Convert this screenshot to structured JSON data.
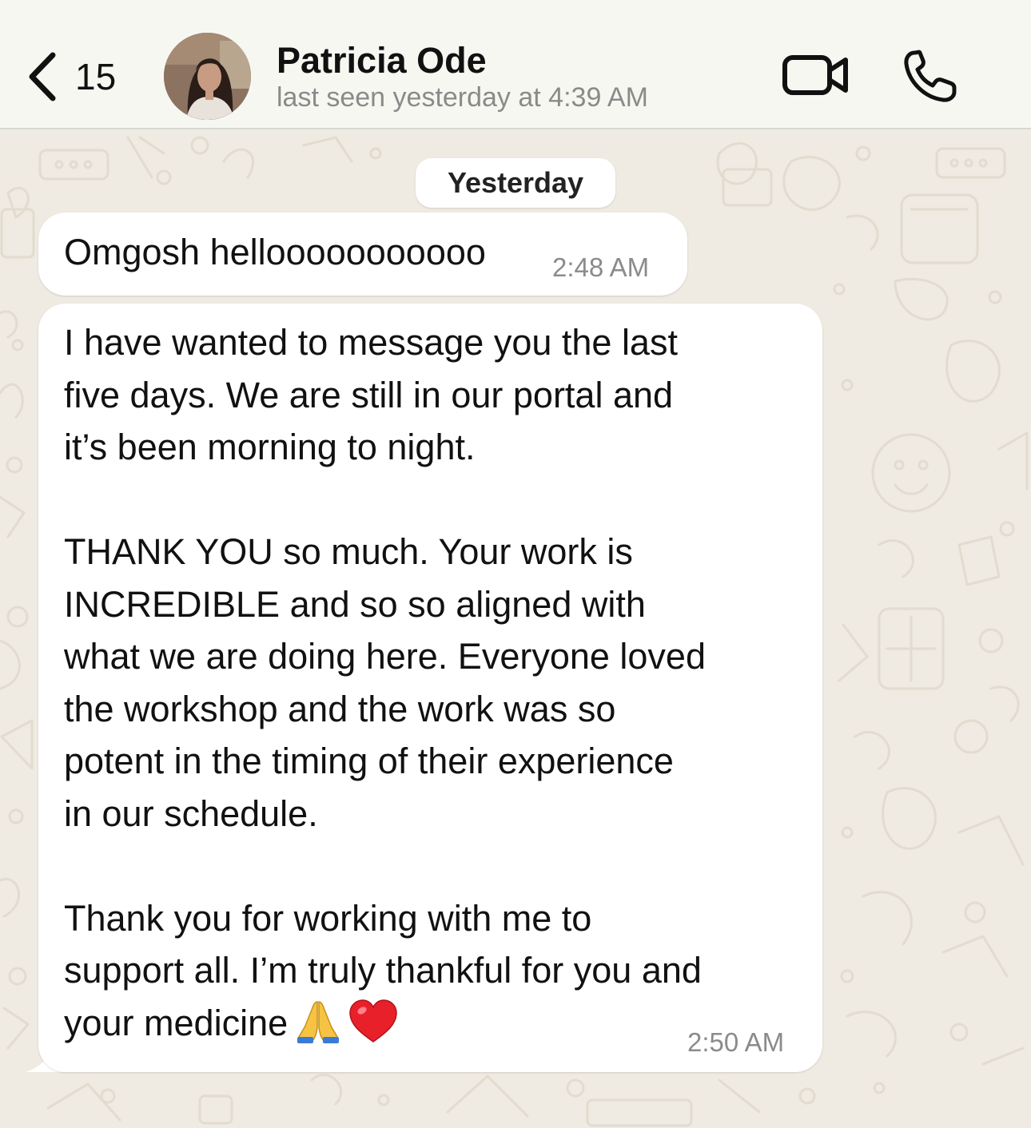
{
  "header": {
    "back_count": "15",
    "contact_name": "Patricia Ode",
    "last_seen": "last seen yesterday at 4:39 AM",
    "icons": [
      "chevron-left-icon",
      "video-camera-icon",
      "phone-icon"
    ]
  },
  "chat": {
    "date_label": "Yesterday",
    "messages": [
      {
        "lines": [
          "Omgosh hellooooooooooo"
        ],
        "time": "2:48 AM"
      },
      {
        "lines": [
          "I have wanted to message you the last",
          "five days. We are still in our portal and",
          "it’s been morning to night.",
          "",
          "THANK YOU so much. Your work is",
          "INCREDIBLE and so so aligned with",
          "what we are doing here. Everyone loved",
          "the workshop and the work was so",
          "potent in the timing of their experience",
          "in our schedule.",
          "",
          "Thank you for working with me to",
          "support all. I’m truly thankful for you and",
          "your medicine"
        ],
        "emojis": [
          "folded-hands-emoji",
          "red-heart-emoji"
        ],
        "time": "2:50 AM"
      }
    ]
  },
  "colors": {
    "header_bg": "#f7f7f2",
    "chat_bg": "#efeae2",
    "bubble_bg": "#ffffff",
    "timestamp": "#8b8b8b",
    "secondary_text": "#8a8a8a"
  }
}
